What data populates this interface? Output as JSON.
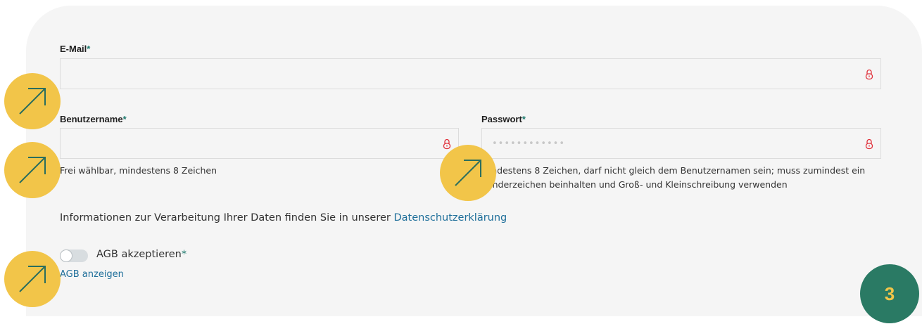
{
  "form": {
    "email": {
      "label": "E-Mail",
      "required_mark": "*",
      "value": "",
      "placeholder": ""
    },
    "username": {
      "label": "Benutzername",
      "required_mark": "*",
      "value": "",
      "placeholder": "",
      "hint": "Frei wählbar, mindestens 8 Zeichen"
    },
    "password": {
      "label": "Passwort",
      "required_mark": "*",
      "value": "",
      "placeholder": "••••••••••••",
      "hint": "Mindestens 8 Zeichen, darf nicht gleich dem Benutzernamen sein; muss zumindest ein Sonderzeichen beinhalten und Groß- und Kleinschreibung verwenden"
    },
    "privacy": {
      "text": "Informationen zur Verarbeitung Ihrer Daten finden Sie in unserer ",
      "link": "Datenschutzerklärung"
    },
    "terms": {
      "label": "AGB akzeptieren",
      "required_mark": "*",
      "toggle_on": false,
      "show_link": "AGB anzeigen"
    }
  },
  "step_badge": "3",
  "icons": {
    "field_lock": "lock-icon",
    "help_bubble": "arrow-up-right-icon"
  },
  "colors": {
    "accent": "#1f7a6e",
    "link": "#1f6f9a",
    "lock": "#e0303a",
    "bubble": "#f2c549",
    "step_bg": "#2a7a64"
  }
}
